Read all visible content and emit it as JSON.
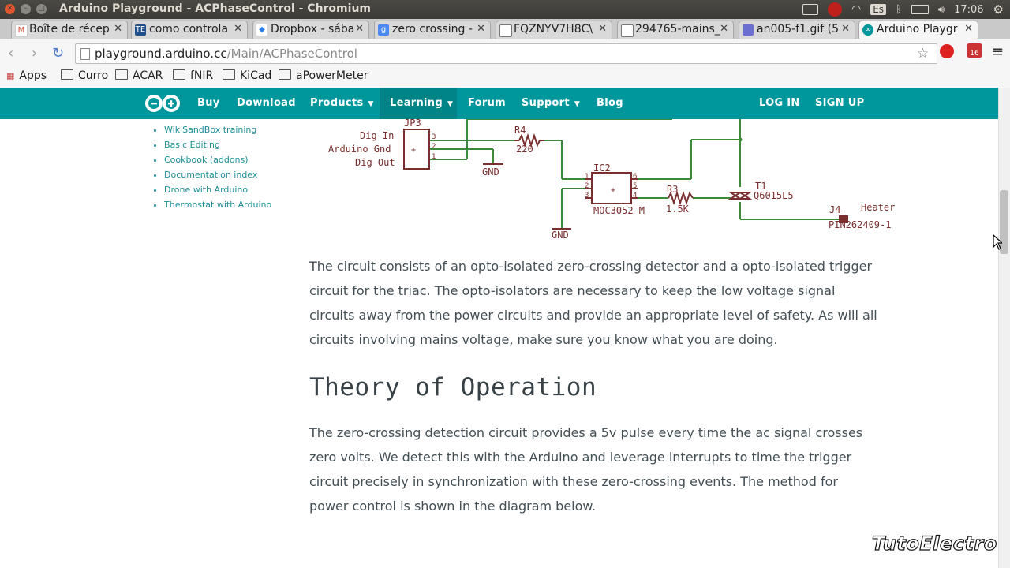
{
  "window": {
    "title": "Arduino Playground - ACPhaseControl - Chromium",
    "tray": {
      "input_lang": "Es",
      "time": "17:06"
    }
  },
  "tabs": [
    {
      "label": "Boîte de récep",
      "icon": "gmail-icon"
    },
    {
      "label": "como controla",
      "icon": "te-icon"
    },
    {
      "label": "Dropbox - sába",
      "icon": "dropbox-icon"
    },
    {
      "label": "zero crossing -",
      "icon": "google-icon"
    },
    {
      "label": "FQZNYV7H8C\\",
      "icon": "page-icon"
    },
    {
      "label": "294765-mains_",
      "icon": "page-icon"
    },
    {
      "label": "an005-f1.gif (5",
      "icon": "image-icon"
    },
    {
      "label": "Arduino Playgr",
      "icon": "arduino-icon"
    }
  ],
  "toolbar": {
    "url_host": "playground.arduino.cc",
    "url_path": "/Main/ACPhaseControl",
    "badge": "16"
  },
  "bookmarks": [
    {
      "label": "Apps",
      "icon": "apps-icon"
    },
    {
      "label": "Curro",
      "icon": "folder-icon"
    },
    {
      "label": "ACAR",
      "icon": "folder-icon"
    },
    {
      "label": "fNIR",
      "icon": "folder-icon"
    },
    {
      "label": "KiCad",
      "icon": "folder-icon"
    },
    {
      "label": "aPowerMeter",
      "icon": "folder-icon"
    }
  ],
  "nav": {
    "buy": "Buy",
    "download": "Download",
    "products": "Products",
    "learning": "Learning",
    "forum": "Forum",
    "support": "Support",
    "blog": "Blog",
    "login": "LOG IN",
    "signup": "SIGN UP"
  },
  "sidebar": {
    "links": [
      "WikiSandBox training",
      "Basic Editing",
      "Cookbook (addons)",
      "Documentation index",
      "Drone with Arduino",
      "Thermostat with Arduino"
    ]
  },
  "schematic": {
    "labels": {
      "jp3": "JP3",
      "dig_in": "Dig In",
      "gnd_label": "Arduino Gnd",
      "dig_out": "Dig Out",
      "pin3": "3",
      "pin2": "2",
      "pin1": "1",
      "plus": "+",
      "r4": "R4",
      "r4_val": "220",
      "gnd1": "GND",
      "ic2": "IC2",
      "ic_val": "MOC3052-M",
      "ic_p1": "1",
      "ic_p2": "2",
      "ic_p3": "3",
      "ic_p4": "4",
      "ic_p5": "5",
      "ic_p6": "6",
      "r3": "R3",
      "r3_val": "1.5K",
      "gnd2": "GND",
      "t1": "T1",
      "t1_val": "Q6015L5",
      "j4": "J4",
      "j4_val": "PIN262409-1",
      "heater": "Heater"
    }
  },
  "content": {
    "para1": "The circuit consists of an opto-isolated zero-crossing detector and a opto-isolated trigger circuit for the triac. The opto-isolators are necessary to keep the low voltage signal circuits away from the power circuits and provide an appropriate level of safety. As will all circuits involving mains voltage, make sure you know what you are doing.",
    "heading": "Theory of Operation",
    "para2": "The zero-crossing detection circuit provides a 5v pulse every time the ac signal crosses zero volts. We detect this with the Arduino and leverage interrupts to time the trigger circuit precisely in synchronization with these zero-crossing events. The method for power control is shown in the diagram below."
  },
  "watermark": "TutoElectro"
}
